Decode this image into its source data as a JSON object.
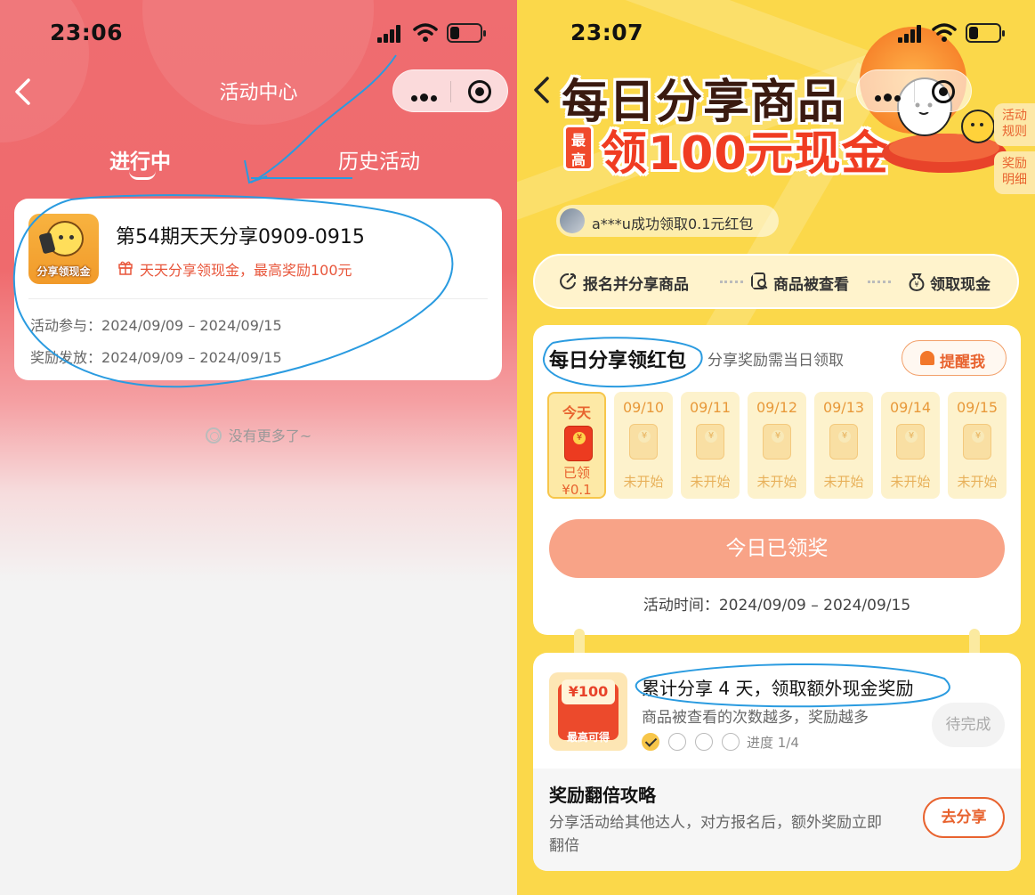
{
  "left_screen": {
    "status": {
      "time": "23:06"
    },
    "nav": {
      "title": "活动中心"
    },
    "tabs": [
      {
        "label": "进行中"
      },
      {
        "label": "历史活动"
      }
    ],
    "activity": {
      "icon_label": "分享领现金",
      "title": "第54期天天分享0909-0915",
      "subtitle": "天天分享领现金，最高奖励100元",
      "participate_label": "活动参与：",
      "participate_dates": "2024/09/09 – 2024/09/15",
      "reward_label": "奖励发放：",
      "reward_dates": "2024/09/09 – 2024/09/15"
    },
    "footer": "没有更多了~"
  },
  "right_screen": {
    "status": {
      "time": "23:07"
    },
    "banner": {
      "line1": "每日分享商品",
      "badge": "最高",
      "line2": "领100元现金"
    },
    "side_tags": [
      "活动规则",
      "奖励明细"
    ],
    "toast": "a***u成功领取0.1元红包",
    "steps": [
      "报名并分享商品",
      "商品被查看",
      "领取现金"
    ],
    "daily": {
      "title": "每日分享领红包",
      "subtitle": "分享奖励需当日领取",
      "remind_label": "提醒我",
      "days": [
        {
          "date": "今天",
          "status": "已领\n¥0.1"
        },
        {
          "date": "09/10",
          "status": "未开始"
        },
        {
          "date": "09/11",
          "status": "未开始"
        },
        {
          "date": "09/12",
          "status": "未开始"
        },
        {
          "date": "09/13",
          "status": "未开始"
        },
        {
          "date": "09/14",
          "status": "未开始"
        },
        {
          "date": "09/15",
          "status": "未开始"
        }
      ],
      "claimed_button": "今日已领奖",
      "activity_time": "活动时间：2024/09/09 – 2024/09/15"
    },
    "cumulative": {
      "envelope_amount": "¥100",
      "envelope_caption": "最高可得",
      "title": "累计分享 4 天，领取额外现金奖励",
      "subtitle": "商品被查看的次数越多，奖励越多",
      "progress_text": "进度 1/4",
      "progress": {
        "done": 1,
        "total": 4
      },
      "status_button": "待完成"
    },
    "strategy": {
      "title": "奖励翻倍攻略",
      "desc": "分享活动给其他达人，对方报名后，额外奖励立即翻倍",
      "share_button": "去分享"
    }
  },
  "colors": {
    "left_header": "#ef6d70",
    "right_bg": "#fbd84a",
    "accent_orange": "#e8632f",
    "annotation_blue": "#2a9be0"
  }
}
